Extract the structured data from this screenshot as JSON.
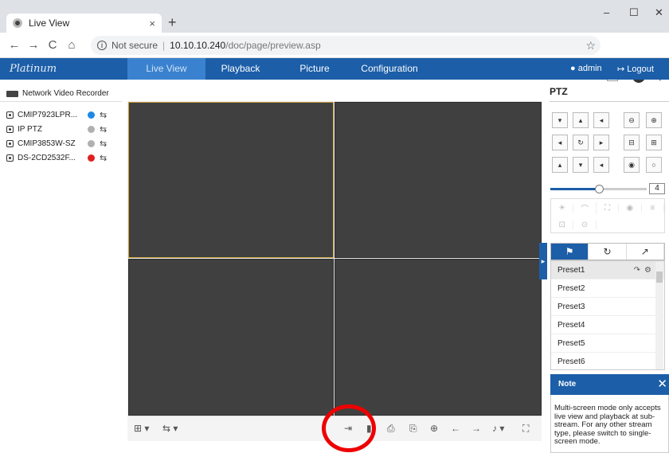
{
  "browser": {
    "tab_title": "Live View",
    "tab_close": "×",
    "new_tab": "+",
    "minimize": "–",
    "maximize": "☐",
    "close": "✕"
  },
  "address": {
    "back": "←",
    "forward": "→",
    "reload": "C",
    "home": "⌂",
    "info": "i",
    "not_secure": "Not secure",
    "separator": "|",
    "host": "10.10.10.240",
    "path": "/doc/page/preview.asp",
    "star": "☆",
    "extension": "▤",
    "account": "●",
    "menu": "⋮"
  },
  "brand": "Platinum",
  "nav": {
    "items": [
      {
        "label": "Live View",
        "active": true
      },
      {
        "label": "Playback"
      },
      {
        "label": "Picture"
      },
      {
        "label": "Configuration"
      }
    ],
    "user": "admin",
    "logout": "Logout"
  },
  "devices": {
    "header": "Network Video Recorder",
    "cameras": [
      {
        "name": "CMIP7923LPR...",
        "status_color": "#1e88e5"
      },
      {
        "name": "IP PTZ",
        "status_color": "#b0b0b0"
      },
      {
        "name": "CMIP3853W-SZ",
        "status_color": "#b0b0b0"
      },
      {
        "name": "DS-2CD2532F...",
        "status_color": "#e02020"
      }
    ],
    "stream_icon": "⇆"
  },
  "layout": {
    "panes": 4,
    "selected_pane": 1
  },
  "toolbar": {
    "left": [
      "⊞ ▾",
      "⇆ ▾"
    ],
    "right": [
      "⇥",
      "▮",
      "⎙",
      "⎘",
      "⊕",
      "←",
      "→",
      "♪ ▾",
      "⛶"
    ]
  },
  "ptz": {
    "title": "PTZ",
    "grid": [
      [
        "▾",
        "▴",
        "◂",
        "⊖",
        "⊕"
      ],
      [
        "◂",
        "↻",
        "▸",
        "⊟",
        "⊞"
      ],
      [
        "▴",
        "▾",
        "◂",
        "◉",
        "○"
      ]
    ],
    "speed_value": "4",
    "speed_fraction": 0.5,
    "functions_row1": [
      "☀",
      "⌒",
      "⛶",
      "◉",
      "≡"
    ],
    "functions_row2": [
      "⊡",
      "⊙",
      "",
      "",
      ""
    ],
    "tabs": [
      "⚑",
      "↻",
      "↗"
    ],
    "presets": [
      "Preset1",
      "Preset2",
      "Preset3",
      "Preset4",
      "Preset5",
      "Preset6"
    ],
    "preset_call": "↷",
    "preset_set": "⚙"
  },
  "note": {
    "title": "Note",
    "close": "✕",
    "body": "Multi-screen mode only accepts live view and playback at sub-stream. For any other stream type, please switch to single-screen mode."
  },
  "colors": {
    "nav": "#1c5ea8",
    "nav_active": "#3a82cf",
    "highlight": "#e00000"
  }
}
